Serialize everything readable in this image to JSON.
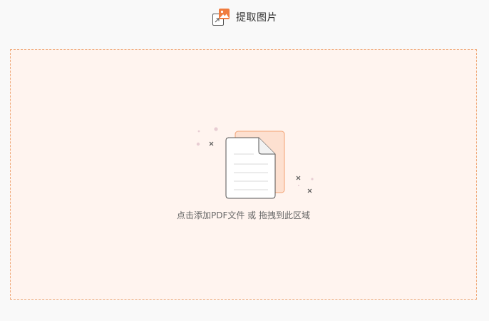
{
  "header": {
    "title": "提取图片",
    "icon": "extract-image-icon"
  },
  "dropzone": {
    "hint_main": "点击添加PDF文件",
    "hint_or": " 或 ",
    "hint_drag": "拖拽到此区域",
    "icon": "pdf-document-icon"
  },
  "colors": {
    "accent": "#f07c3e",
    "dropzone_bg": "#fff4ef",
    "dropzone_border": "#f0a878",
    "page_bg": "#f9f9f9",
    "text": "#333333",
    "hint_text": "#666666"
  }
}
